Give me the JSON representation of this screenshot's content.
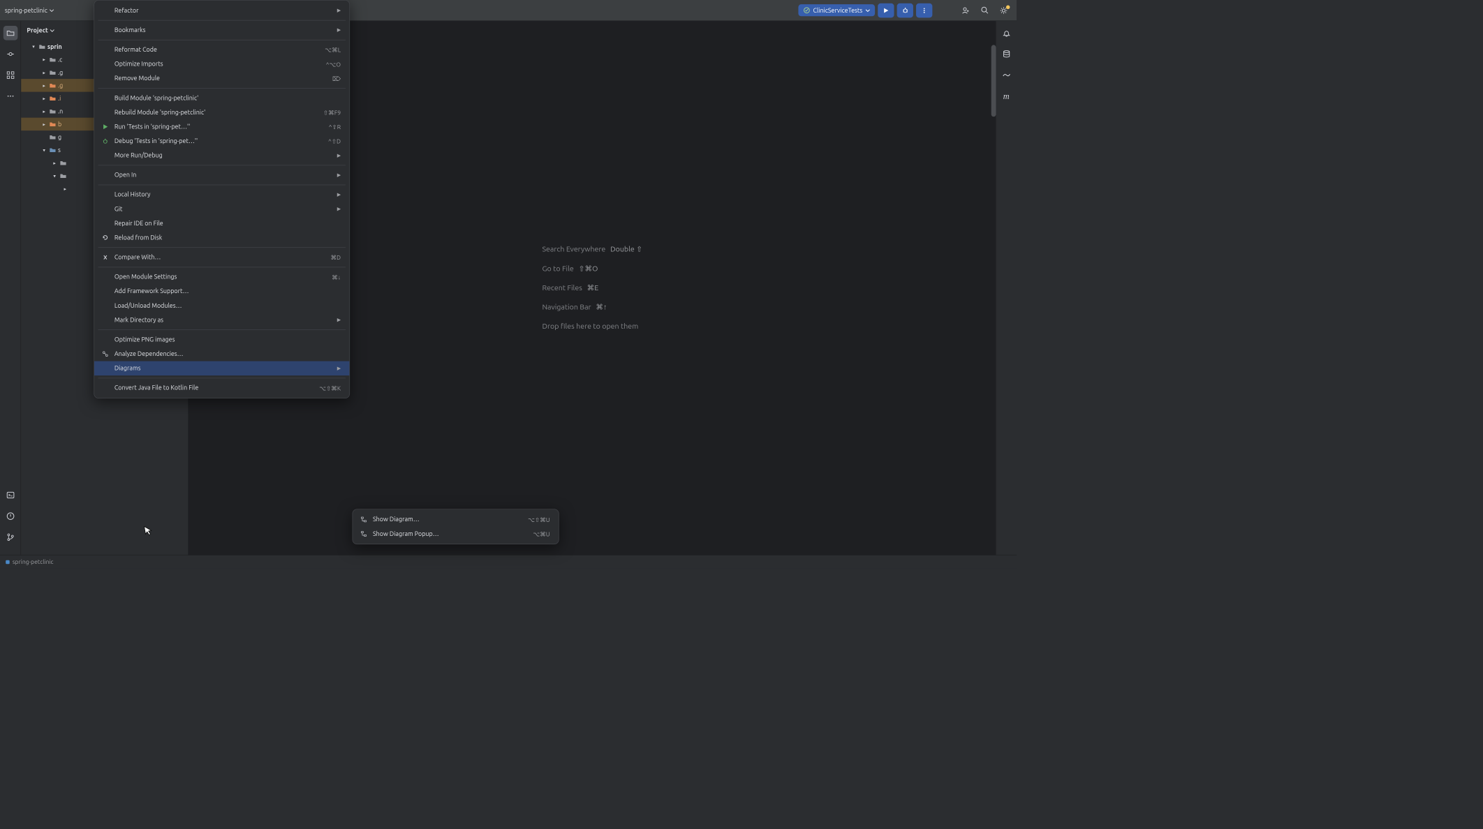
{
  "titlebar": {
    "project": "spring-petclinic",
    "runConfig": "ClinicServiceTests"
  },
  "panel": {
    "title": "Project"
  },
  "tree": {
    "root": "sprin",
    "items": [
      ".c",
      ".g",
      ".g",
      ".i",
      ".n",
      "b",
      "g",
      "s"
    ]
  },
  "welcome": {
    "l1": "Search Everywhere",
    "k1": "Double ⇧",
    "l2": "Go to File",
    "k2": "⇧⌘O",
    "l3": "Recent Files",
    "k3": "⌘E",
    "l4": "Navigation Bar",
    "k4": "⌘↑",
    "l5": "Drop files here to open them"
  },
  "menu": {
    "refactor": "Refactor",
    "bookmarks": "Bookmarks",
    "reformat": "Reformat Code",
    "reformatKey": "⌥⌘L",
    "optimizeImports": "Optimize Imports",
    "optimizeImportsKey": "^⌥O",
    "removeModule": "Remove Module",
    "removeModuleKey": "⌦",
    "buildModule": "Build Module 'spring-petclinic'",
    "rebuildModule": "Rebuild Module 'spring-petclinic'",
    "rebuildModuleKey": "⇧⌘F9",
    "runTests": "Run 'Tests in 'spring-pet…''",
    "runTestsKey": "^⇧R",
    "debugTests": "Debug 'Tests in 'spring-pet…''",
    "debugTestsKey": "^⇧D",
    "moreRun": "More Run/Debug",
    "openIn": "Open In",
    "localHistory": "Local History",
    "git": "Git",
    "repairIde": "Repair IDE on File",
    "reload": "Reload from Disk",
    "compare": "Compare With…",
    "compareKey": "⌘D",
    "openModule": "Open Module Settings",
    "openModuleKey": "⌘↓",
    "addFramework": "Add Framework Support…",
    "loadUnload": "Load/Unload Modules…",
    "markDir": "Mark Directory as",
    "optimizePng": "Optimize PNG images",
    "analyzeDeps": "Analyze Dependencies…",
    "diagrams": "Diagrams",
    "convertKotlin": "Convert Java File to Kotlin File",
    "convertKotlinKey": "⌥⇧⌘K"
  },
  "submenu": {
    "showDiagram": "Show Diagram…",
    "showDiagramKey": "⌥⇧⌘U",
    "showPopup": "Show Diagram Popup…",
    "showPopupKey": "⌥⌘U"
  },
  "statusbar": {
    "module": "spring-petclinic"
  }
}
